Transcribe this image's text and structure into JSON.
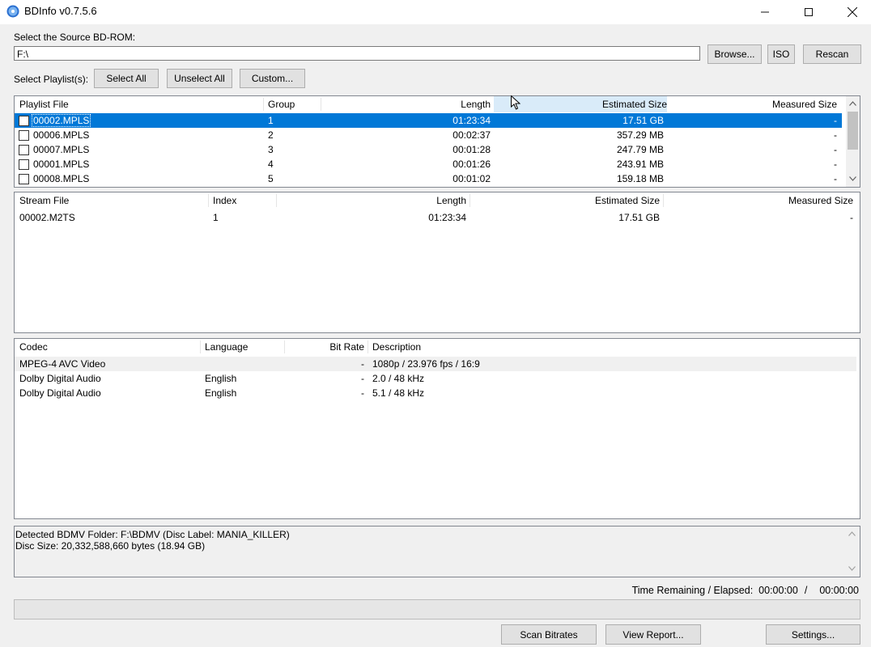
{
  "window": {
    "title": "BDInfo v0.7.5.6",
    "controls": {
      "minimize": "minimize",
      "maximize": "maximize",
      "close": "close"
    }
  },
  "source": {
    "label": "Select the Source BD-ROM:",
    "path": "F:\\",
    "browse_label": "Browse...",
    "iso_label": "ISO",
    "rescan_label": "Rescan"
  },
  "playlist_select": {
    "label": "Select Playlist(s):",
    "select_all_label": "Select All",
    "unselect_all_label": "Unselect All",
    "custom_label": "Custom..."
  },
  "playlists": {
    "headers": {
      "file": "Playlist File",
      "group": "Group",
      "length": "Length",
      "estimated": "Estimated Size",
      "measured": "Measured Size"
    },
    "rows": [
      {
        "file": "00002.MPLS",
        "group": "1",
        "length": "01:23:34",
        "estimated": "17.51 GB",
        "measured": "-",
        "selected": true
      },
      {
        "file": "00006.MPLS",
        "group": "2",
        "length": "00:02:37",
        "estimated": "357.29 MB",
        "measured": "-"
      },
      {
        "file": "00007.MPLS",
        "group": "3",
        "length": "00:01:28",
        "estimated": "247.79 MB",
        "measured": "-"
      },
      {
        "file": "00001.MPLS",
        "group": "4",
        "length": "00:01:26",
        "estimated": "243.91 MB",
        "measured": "-"
      },
      {
        "file": "00008.MPLS",
        "group": "5",
        "length": "00:01:02",
        "estimated": "159.18 MB",
        "measured": "-"
      }
    ]
  },
  "streams": {
    "headers": {
      "file": "Stream File",
      "index": "Index",
      "length": "Length",
      "estimated": "Estimated Size",
      "measured": "Measured Size"
    },
    "rows": [
      {
        "file": "00002.M2TS",
        "index": "1",
        "length": "01:23:34",
        "estimated": "17.51 GB",
        "measured": "-"
      }
    ]
  },
  "codecs": {
    "headers": {
      "codec": "Codec",
      "language": "Language",
      "bitrate": "Bit Rate",
      "description": "Description"
    },
    "rows": [
      {
        "codec": "MPEG-4 AVC Video",
        "language": "",
        "bitrate": "-",
        "description": "1080p / 23.976 fps / 16:9",
        "highlight": true
      },
      {
        "codec": "Dolby Digital Audio",
        "language": "English",
        "bitrate": "-",
        "description": "2.0 / 48 kHz"
      },
      {
        "codec": "Dolby Digital Audio",
        "language": "English",
        "bitrate": "-",
        "description": "5.1 / 48 kHz"
      }
    ]
  },
  "info": {
    "line1": "Detected BDMV Folder: F:\\BDMV (Disc Label: MANIA_KILLER)",
    "line2": "Disc Size: 20,332,588,660 bytes (18.94 GB)"
  },
  "time": {
    "label": "Time Remaining / Elapsed:",
    "remaining": "00:00:00",
    "separator": "/",
    "elapsed": "00:00:00"
  },
  "progress": {
    "value": 0
  },
  "actions": {
    "scan_label": "Scan Bitrates",
    "report_label": "View Report...",
    "settings_label": "Settings..."
  },
  "colors": {
    "selection": "#0078d7",
    "header_hover": "#d9ebf9",
    "row_highlight": "#f0f0f0"
  }
}
